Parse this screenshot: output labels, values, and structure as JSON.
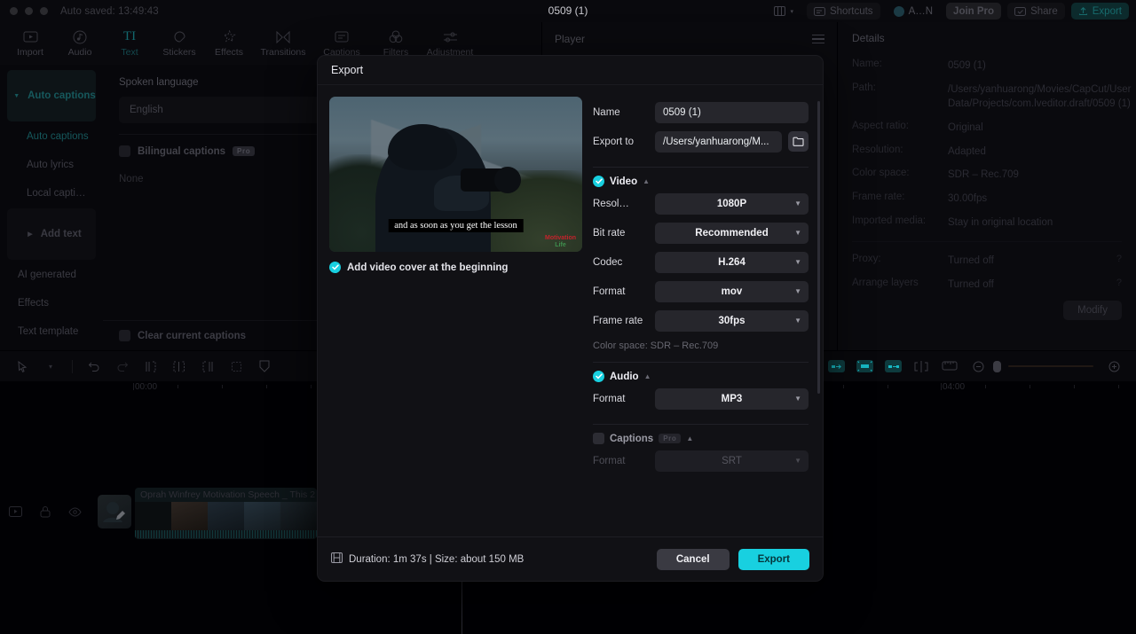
{
  "titlebar": {
    "autosave": "Auto saved: 13:49:43",
    "project_title": "0509 (1)",
    "shortcuts": "Shortcuts",
    "account": "A…N",
    "join_pro": "Join Pro",
    "share": "Share",
    "export": "Export"
  },
  "tooltabs": [
    {
      "label": "Import",
      "icon": "import-icon"
    },
    {
      "label": "Audio",
      "icon": "audio-icon"
    },
    {
      "label": "Text",
      "icon": "text-icon"
    },
    {
      "label": "Stickers",
      "icon": "stickers-icon"
    },
    {
      "label": "Effects",
      "icon": "effects-icon"
    },
    {
      "label": "Transitions",
      "icon": "transitions-icon"
    },
    {
      "label": "Captions",
      "icon": "captions-icon"
    },
    {
      "label": "Filters",
      "icon": "filters-icon"
    },
    {
      "label": "Adjustment",
      "icon": "adjustment-icon"
    }
  ],
  "sidebar": {
    "items": [
      {
        "label": "Auto captions"
      },
      {
        "label": "Auto captions"
      },
      {
        "label": "Auto lyrics"
      },
      {
        "label": "Local capti…"
      },
      {
        "label": "Add text"
      },
      {
        "label": "AI generated"
      },
      {
        "label": "Effects"
      },
      {
        "label": "Text template"
      }
    ]
  },
  "captions_panel": {
    "spoken_language_label": "Spoken language",
    "spoken_language_value": "English",
    "bilingual_label": "Bilingual captions",
    "pro_badge": "Pro",
    "bilingual_value": "None",
    "clear_label": "Clear current captions"
  },
  "player": {
    "title": "Player"
  },
  "details": {
    "title": "Details",
    "rows": [
      {
        "key": "Name:",
        "value": "0509 (1)"
      },
      {
        "key": "Path:",
        "value": "/Users/yanhuarong/Movies/CapCut/User Data/Projects/com.lveditor.draft/0509 (1)"
      },
      {
        "key": "Aspect ratio:",
        "value": "Original"
      },
      {
        "key": "Resolution:",
        "value": "Adapted"
      },
      {
        "key": "Color space:",
        "value": "SDR – Rec.709"
      },
      {
        "key": "Frame rate:",
        "value": "30.00fps"
      },
      {
        "key": "Imported media:",
        "value": "Stay in original location"
      }
    ],
    "rows2": [
      {
        "key": "Proxy:",
        "value": "Turned off",
        "help": "?"
      },
      {
        "key": "Arrange layers",
        "value": "Turned off",
        "help": "?"
      }
    ],
    "modify": "Modify"
  },
  "timeline": {
    "ruler_start": "00:00",
    "ruler_mid": "04:00",
    "clip_title": "Oprah Winfrey Motivation Speech _ This 2"
  },
  "modal": {
    "title": "Export",
    "preview": {
      "caption": "and as soon as you get the lesson",
      "watermark_top": "Motivation",
      "watermark_bottom": "Life"
    },
    "add_cover_label": "Add video cover at the beginning",
    "name_label": "Name",
    "name_value": "0509 (1)",
    "export_to_label": "Export to",
    "export_to_value": "/Users/yanhuarong/M...",
    "folder_icon": "folder-icon",
    "video": {
      "group_label": "Video",
      "fields": [
        {
          "label": "Resol…",
          "value": "1080P"
        },
        {
          "label": "Bit rate",
          "value": "Recommended"
        },
        {
          "label": "Codec",
          "value": "H.264"
        },
        {
          "label": "Format",
          "value": "mov"
        },
        {
          "label": "Frame rate",
          "value": "30fps"
        }
      ],
      "color_space": "Color space: SDR – Rec.709"
    },
    "audio": {
      "group_label": "Audio",
      "format_label": "Format",
      "format_value": "MP3"
    },
    "captions": {
      "group_label": "Captions",
      "pro_badge": "Pro",
      "format_label": "Format",
      "format_value": "SRT"
    },
    "footer": {
      "summary": "Duration: 1m 37s | Size: about 150 MB",
      "cancel": "Cancel",
      "export": "Export"
    }
  }
}
